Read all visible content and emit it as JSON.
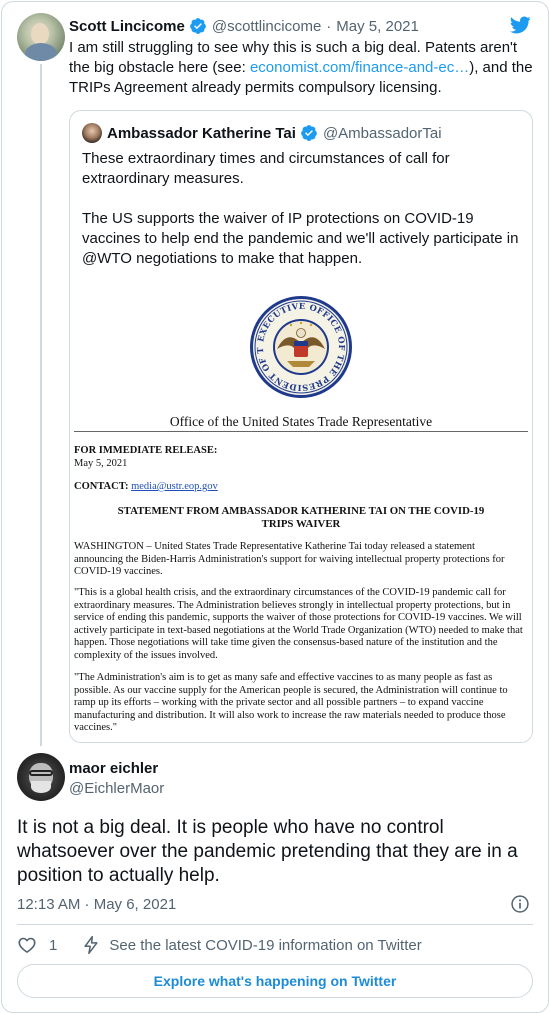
{
  "tweet": {
    "author_name": "Scott Lincicome",
    "author_handle": "@scottlincicome",
    "separator": "·",
    "date": "May 5, 2021",
    "text_before_link": "I am still struggling to see why this is such a big deal. Patents aren't the big obstacle here (see: ",
    "link_text": "economist.com/finance-and-ec…",
    "text_after_link": "), and the TRIPs Agreement already permits compulsory licensing."
  },
  "quoted_tweet": {
    "author_name": "Ambassador Katherine Tai",
    "author_handle": "@AmbassadorTai",
    "paragraph_1": "These extraordinary times and circumstances of call for extraordinary measures.",
    "paragraph_2": "The US supports the waiver of IP protections on COVID-19 vaccines to help end the pandemic and we'll actively participate in @WTO negotiations to make that happen.",
    "image": {
      "seal_text": "EXECUTIVE OFFICE OF THE PRESIDENT OF THE UNITED STATES",
      "office_title": "Office of the United States Trade Representative",
      "release_label": "FOR IMMEDIATE RELEASE:",
      "release_date": "May 5, 2021",
      "contact_label": "CONTACT:",
      "contact_email": "media@ustr.eop.gov",
      "headline": "STATEMENT FROM AMBASSADOR KATHERINE TAI ON THE COVID-19 TRIPS WAIVER",
      "para_1": "WASHINGTON – United States Trade Representative Katherine Tai today released a statement announcing the Biden-Harris Administration's support for waiving intellectual property protections for COVID-19 vaccines.",
      "para_2": "\"This is a global health crisis, and the extraordinary circumstances of the COVID-19 pandemic call for extraordinary measures.  The Administration believes strongly in intellectual property protections, but in service of ending this pandemic, supports the waiver of those protections for COVID-19 vaccines. We will actively participate in text-based negotiations at the World Trade Organization (WTO) needed to make that happen. Those negotiations will take time given the consensus-based nature of the institution and the complexity of the issues involved.",
      "para_3": "\"The Administration's aim is to get as many safe and effective vaccines to as many people as fast as possible.  As our vaccine supply for the American people is secured, the Administration will continue to ramp up its efforts – working with the private sector and all possible partners – to expand vaccine manufacturing and distribution.  It will also work to increase the raw materials needed to produce those vaccines.\""
    }
  },
  "reply": {
    "author_name": "maor eichler",
    "author_handle": "@EichlerMaor",
    "text": "It is not a big deal. It is people who have no control whatsoever over the pandemic pretending that they are in a position to actually help.",
    "timestamp": "12:13 AM · May 6, 2021",
    "like_count": "1",
    "covid_info_text": "See the latest COVID-19 information on Twitter",
    "explore_label": "Explore what's happening on Twitter"
  },
  "icons": {
    "verified": "verified-badge-icon",
    "bird": "twitter-bird-icon",
    "heart": "heart-icon",
    "bolt": "lightning-bolt-icon",
    "info": "info-icon"
  },
  "colors": {
    "link": "#1d9bf0",
    "text": "#0f1419",
    "secondary": "#536471",
    "border": "#cfd9de"
  }
}
